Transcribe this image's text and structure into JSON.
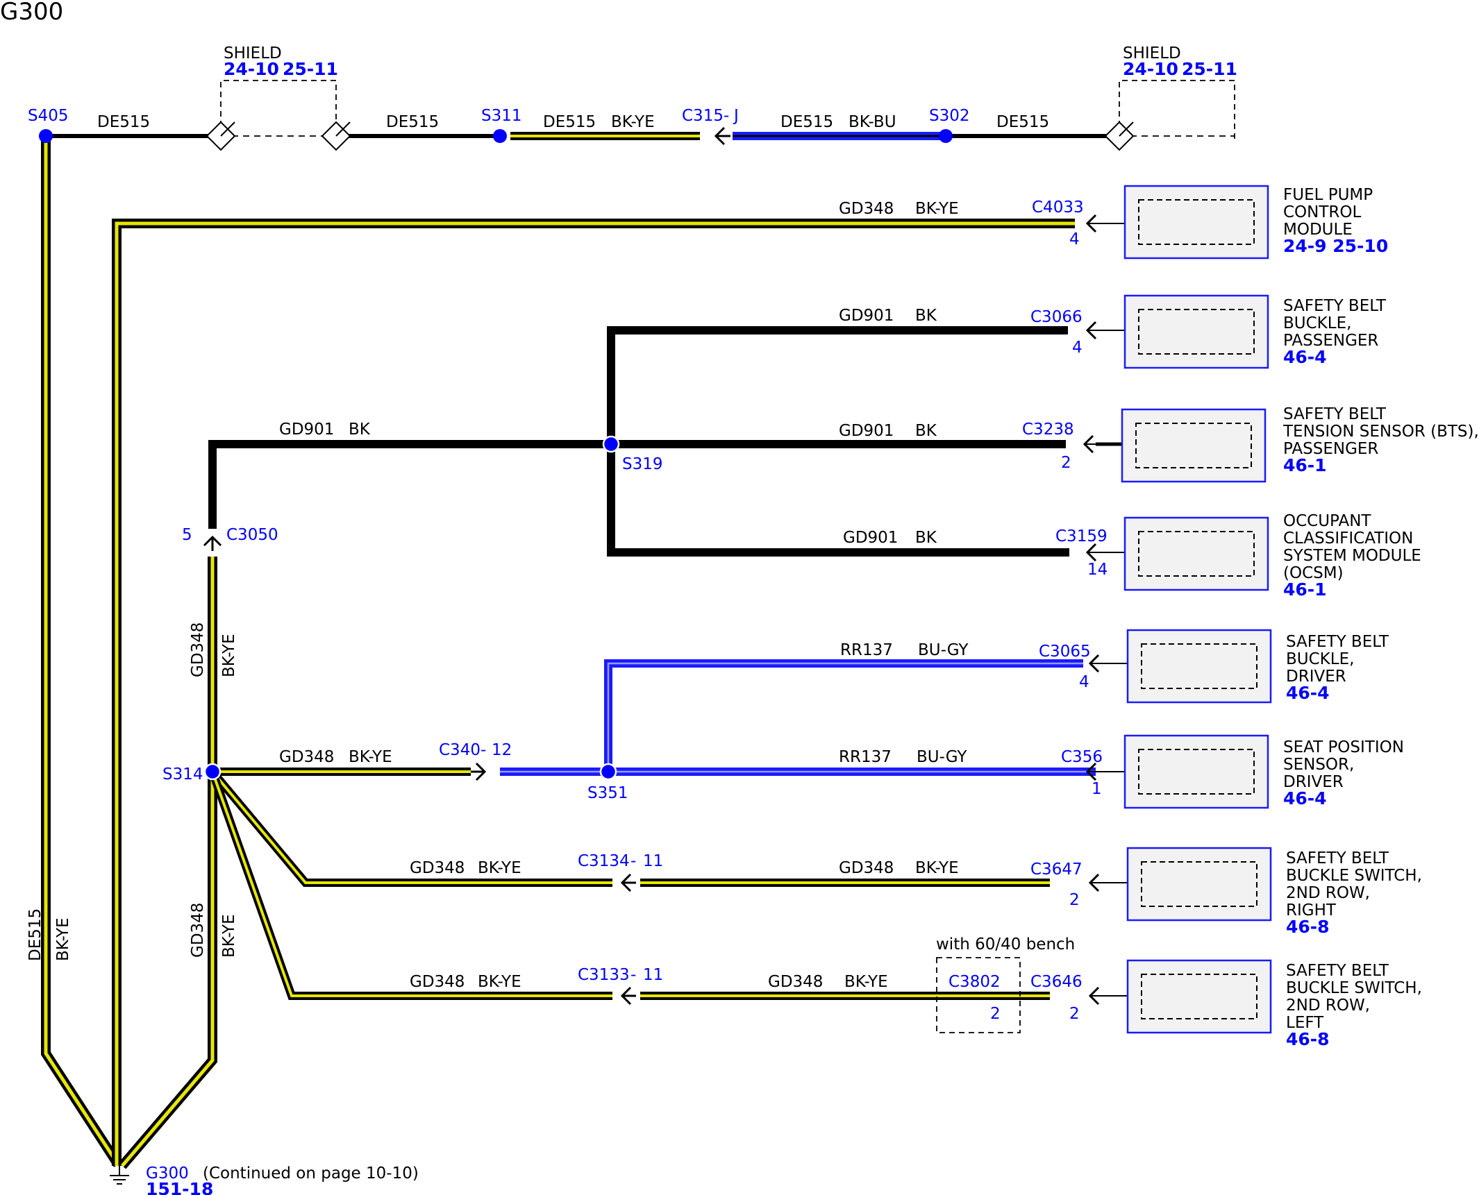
{
  "title": "G300",
  "colors": {
    "black": "#000000",
    "yellow": "#e6e600",
    "blue": "#1a1aff",
    "reference_blue": "#0000ff"
  },
  "top_row": {
    "shield_left": {
      "label": "SHIELD",
      "ref1": "24-10",
      "ref2": "25-11"
    },
    "shield_right": {
      "label": "SHIELD",
      "ref1": "24-10",
      "ref2": "25-11"
    },
    "s405": "S405",
    "s311": "S311",
    "s302": "S302",
    "c315": "C315",
    "c315_pin": "J",
    "seg1": "DE515",
    "seg2": "DE515",
    "seg3_circuit": "DE515",
    "seg3_color": "BK-YE",
    "seg4_circuit": "DE515",
    "seg4_color": "BK-BU",
    "seg5": "DE515"
  },
  "vertical_labels": {
    "left_circuit": "DE515",
    "left_color": "BK-YE",
    "upper_circuit": "GD348",
    "upper_color": "BK-YE",
    "lower_circuit": "GD348",
    "lower_color": "BK-YE"
  },
  "splices": {
    "s319": "S319",
    "s314": "S314",
    "s351": "S351"
  },
  "c3050": {
    "name": "C3050",
    "pin": "5"
  },
  "c340": {
    "name": "C340",
    "pin": "12"
  },
  "c3134": {
    "name": "C3134",
    "pin": "11"
  },
  "c3133": {
    "name": "C3133",
    "pin": "11"
  },
  "c3802": {
    "name": "C3802",
    "pin": "2",
    "note": "with 60/40 bench"
  },
  "wires": {
    "w4033": {
      "circuit": "GD348",
      "color": "BK-YE"
    },
    "w3066": {
      "circuit": "GD901",
      "color": "BK"
    },
    "w3050": {
      "circuit": "GD901",
      "color": "BK"
    },
    "w3238": {
      "circuit": "GD901",
      "color": "BK"
    },
    "w3159": {
      "circuit": "GD901",
      "color": "BK"
    },
    "w3065": {
      "circuit": "RR137",
      "color": "BU-GY"
    },
    "w340": {
      "circuit": "GD348",
      "color": "BK-YE"
    },
    "w356": {
      "circuit": "RR137",
      "color": "BU-GY"
    },
    "w3134": {
      "circuit": "GD348",
      "color": "BK-YE"
    },
    "w3647": {
      "circuit": "GD348",
      "color": "BK-YE"
    },
    "w3133": {
      "circuit": "GD348",
      "color": "BK-YE"
    },
    "w3646": {
      "circuit": "GD348",
      "color": "BK-YE"
    }
  },
  "components": [
    {
      "connector": "C4033",
      "pin": "4",
      "name": [
        "FUEL PUMP",
        "CONTROL",
        "MODULE"
      ],
      "ref": "24-9  25-10"
    },
    {
      "connector": "C3066",
      "pin": "4",
      "name": [
        "SAFETY BELT",
        "BUCKLE,",
        "PASSENGER"
      ],
      "ref": "46-4"
    },
    {
      "connector": "C3238",
      "pin": "2",
      "name": [
        "SAFETY BELT",
        "TENSION SENSOR (BTS),",
        "PASSENGER"
      ],
      "ref": "46-1"
    },
    {
      "connector": "C3159",
      "pin": "14",
      "name": [
        "OCCUPANT",
        "CLASSIFICATION",
        "SYSTEM MODULE",
        "(OCSM)"
      ],
      "ref": "46-1"
    },
    {
      "connector": "C3065",
      "pin": "4",
      "name": [
        "SAFETY BELT",
        "BUCKLE,",
        "DRIVER"
      ],
      "ref": "46-4"
    },
    {
      "connector": "C356",
      "pin": "1",
      "name": [
        "SEAT POSITION",
        "SENSOR,",
        "DRIVER"
      ],
      "ref": "46-4"
    },
    {
      "connector": "C3647",
      "pin": "2",
      "name": [
        "SAFETY BELT",
        "BUCKLE SWITCH,",
        "2ND ROW,",
        "RIGHT"
      ],
      "ref": "46-8"
    },
    {
      "connector": "C3646",
      "pin": "2",
      "name": [
        "SAFETY BELT",
        "BUCKLE SWITCH,",
        "2ND ROW,",
        "LEFT"
      ],
      "ref": "46-8"
    }
  ],
  "ground": {
    "name": "G300",
    "ref": "151-18",
    "note": "(Continued on page 10-10)"
  }
}
